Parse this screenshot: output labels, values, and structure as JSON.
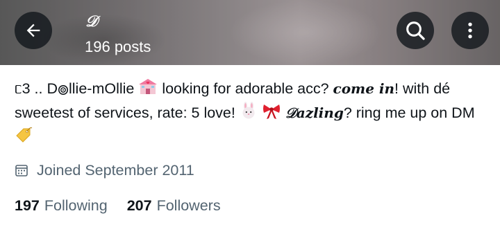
{
  "header": {
    "display_name": "𝒟",
    "posts_count": "196 posts",
    "back_icon": "arrow-left-icon",
    "search_icon": "search-icon",
    "more_icon": "more-vertical-icon"
  },
  "bio": {
    "part1": "ᥴ3 .. D",
    "part2": "llie-mOllie ",
    "part3": " looking for adorable acc? ",
    "come_in": "come in",
    "part4": "! with dé sweetest of services, rate: 5 love! ",
    "dazling": "𝒟azling",
    "part5": "? ring me up on DM ",
    "emojis": [
      "bullseye-o",
      "love-hotel",
      "rabbit-face",
      "ribbon",
      "label-tag"
    ]
  },
  "joined": {
    "icon": "calendar-icon",
    "text": "Joined September 2011"
  },
  "stats": {
    "following_count": "197",
    "following_label": "Following",
    "followers_count": "207",
    "followers_label": "Followers"
  },
  "colors": {
    "text_primary": "#0f1419",
    "text_secondary": "#536471",
    "button_bg": "#0f1419"
  }
}
